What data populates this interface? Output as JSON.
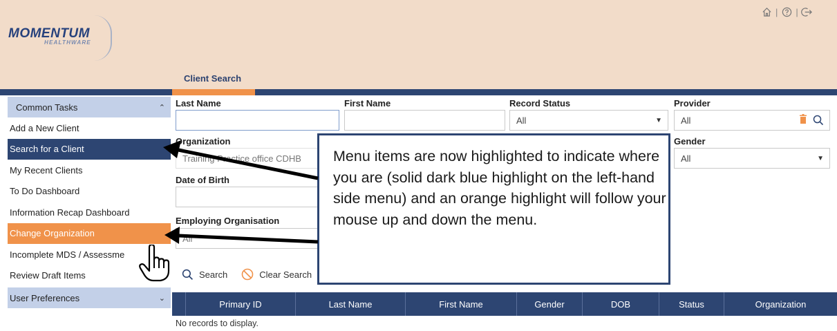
{
  "header": {
    "logo_main": "MOMENTUM",
    "logo_sub": "HEALTHWARE",
    "icons": [
      "home-icon",
      "help-icon",
      "logout-icon"
    ],
    "page_tab": "Client Search"
  },
  "sidebar": {
    "section_title": "Common Tasks",
    "items": [
      {
        "label": "Add a New Client",
        "state": "normal"
      },
      {
        "label": "Search for a Client",
        "state": "active"
      },
      {
        "label": "My Recent Clients",
        "state": "normal"
      },
      {
        "label": "To Do Dashboard",
        "state": "normal"
      },
      {
        "label": "Information Recap Dashboard",
        "state": "normal"
      },
      {
        "label": "Change Organization",
        "state": "hover"
      },
      {
        "label": "Incomplete MDS / Assessme",
        "state": "normal"
      },
      {
        "label": "Review Draft Items",
        "state": "normal"
      }
    ],
    "footer_title": "User Preferences"
  },
  "form": {
    "last_name_label": "Last Name",
    "last_name_value": "",
    "first_name_label": "First Name",
    "first_name_value": "",
    "record_status_label": "Record Status",
    "record_status_value": "All",
    "provider_label": "Provider",
    "provider_value": "All",
    "organization_label": "Organization",
    "organization_value": "Training Practice office CDHB",
    "gender_label": "Gender",
    "gender_value": "All",
    "dob_label": "Date of Birth",
    "employing_label": "Employing Organisation",
    "employing_value": "All"
  },
  "actions": {
    "search": "Search",
    "clear": "Clear Search"
  },
  "grid": {
    "columns": [
      "Primary ID",
      "Last Name",
      "First Name",
      "Gender",
      "DOB",
      "Status",
      "Organization"
    ],
    "empty_text": "No records to display."
  },
  "callout": {
    "text": "Menu items are now highlighted to indicate where you are (solid dark blue highlight on the left-hand side menu) and an orange highlight will follow your mouse up and down the menu."
  },
  "colors": {
    "header_bg": "#f2dcc9",
    "navy": "#2d4572",
    "orange": "#f0924a",
    "sidebar_head": "#c3d0e8"
  }
}
